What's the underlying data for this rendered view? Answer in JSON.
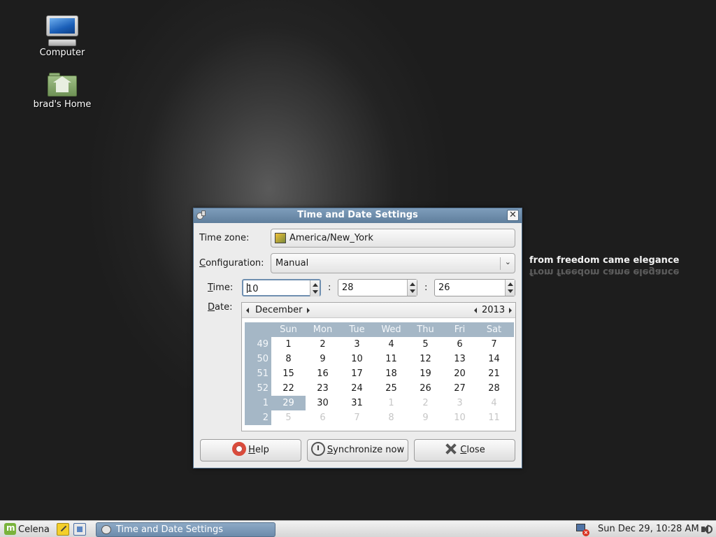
{
  "desktop": {
    "icons": [
      {
        "label": "Computer"
      },
      {
        "label": "brad's Home"
      }
    ],
    "tagline": "from freedom came elegance"
  },
  "dialog": {
    "title": "Time and Date Settings",
    "timezone_label": "Time zone:",
    "timezone_value": "America/New_York",
    "configuration_label_first": "C",
    "configuration_label_rest": "onfiguration:",
    "configuration_value": "Manual",
    "time_label_first": "T",
    "time_label_rest": "ime:",
    "time_hour": "10",
    "time_minute": "28",
    "time_second": "26",
    "time_separator": ":",
    "date_label_first": "D",
    "date_label_rest": "ate:",
    "calendar": {
      "month": "December",
      "year": "2013",
      "weekdays": [
        "Sun",
        "Mon",
        "Tue",
        "Wed",
        "Thu",
        "Fri",
        "Sat"
      ],
      "weeks": [
        {
          "num": "49",
          "days": [
            "1",
            "2",
            "3",
            "4",
            "5",
            "6",
            "7"
          ]
        },
        {
          "num": "50",
          "days": [
            "8",
            "9",
            "10",
            "11",
            "12",
            "13",
            "14"
          ]
        },
        {
          "num": "51",
          "days": [
            "15",
            "16",
            "17",
            "18",
            "19",
            "20",
            "21"
          ]
        },
        {
          "num": "52",
          "days": [
            "22",
            "23",
            "24",
            "25",
            "26",
            "27",
            "28"
          ]
        },
        {
          "num": "1",
          "days": [
            "29",
            "30",
            "31",
            "1",
            "2",
            "3",
            "4"
          ]
        },
        {
          "num": "2",
          "days": [
            "5",
            "6",
            "7",
            "8",
            "9",
            "10",
            "11"
          ]
        }
      ],
      "selected_day": "29"
    },
    "buttons": {
      "help_first": "H",
      "help_rest": "elp",
      "sync_first": "S",
      "sync_rest": "ynchronize now",
      "close_first": "C",
      "close_rest": "lose"
    },
    "close_glyph": "✕"
  },
  "panel": {
    "menu_label": "Celena",
    "task_label": "Time and Date Settings",
    "clock": "Sun Dec 29, 10:28 AM",
    "net_badge": "×"
  },
  "colors": {
    "titlebar": "#6f8ead",
    "calendar_header": "#a5b7c6",
    "panel": "#e4e4e4"
  }
}
